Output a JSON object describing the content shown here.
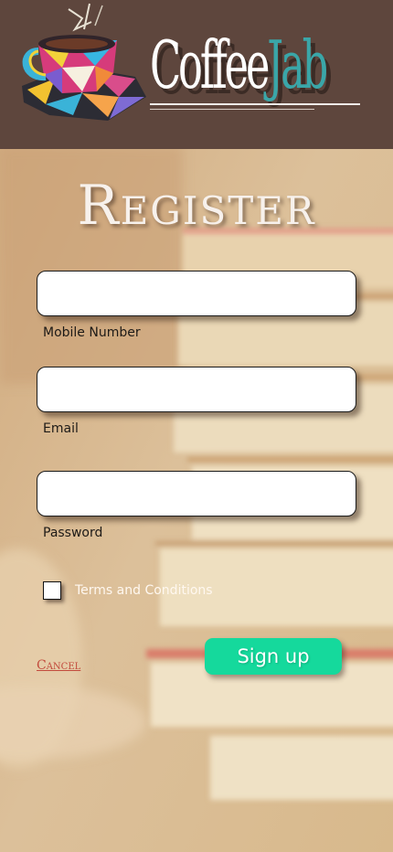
{
  "header": {
    "brand_part1": "Coffee",
    "brand_part2": "Jab",
    "logo_icon": "coffee-cup-icon",
    "colors": {
      "background": "#5e463d",
      "brand_primary": "#ffffff",
      "brand_accent": "#3aa6a8"
    }
  },
  "form": {
    "title": "Register",
    "fields": [
      {
        "label": "Mobile Number",
        "value": "",
        "type": "tel"
      },
      {
        "label": "Email",
        "value": "",
        "type": "email"
      },
      {
        "label": "Password",
        "value": "",
        "type": "password"
      }
    ],
    "terms_label": "Terms and Conditions",
    "terms_checked": false,
    "cancel_label": "Cancel",
    "signup_label": "Sign up",
    "colors": {
      "signup": "#15d99c",
      "cancel": "#c24a3c"
    }
  }
}
